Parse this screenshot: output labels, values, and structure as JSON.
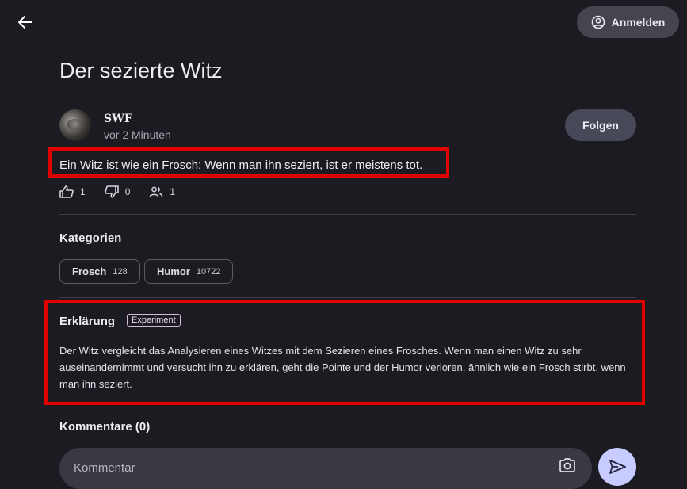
{
  "header": {
    "login_label": "Anmelden"
  },
  "post": {
    "title": "Der sezierte Witz",
    "author": "SWF",
    "time": "vor 2 Minuten",
    "follow_label": "Folgen",
    "text": "Ein Witz ist wie ein Frosch: Wenn man ihn seziert, ist er meistens tot.",
    "reactions": {
      "likes": "1",
      "dislikes": "0",
      "people": "1"
    }
  },
  "categories": {
    "title": "Kategorien",
    "items": [
      {
        "label": "Frosch",
        "count": "128"
      },
      {
        "label": "Humor",
        "count": "10722"
      }
    ]
  },
  "explanation": {
    "title": "Erklärung",
    "badge": "Experiment",
    "text": "Der Witz vergleicht das Analysieren eines Witzes mit dem Sezieren eines Frosches. Wenn man einen Witz zu sehr auseinandernimmt und versucht ihn zu erklären, geht die Pointe und der Humor verloren, ähnlich wie ein Frosch stirbt, wenn man ihn seziert."
  },
  "comments": {
    "title": "Kommentare (0)",
    "placeholder": "Kommentar"
  },
  "colors": {
    "background": "#1c1b22",
    "highlight": "#e00000",
    "send_button": "#c7cbff",
    "badge_border": "#d6b7d8"
  },
  "icons": {
    "back": "arrow-left-icon",
    "login": "account-circle-icon",
    "like": "thumb-up-icon",
    "dislike": "thumb-down-icon",
    "people": "group-icon",
    "camera": "camera-icon",
    "send": "send-icon"
  }
}
